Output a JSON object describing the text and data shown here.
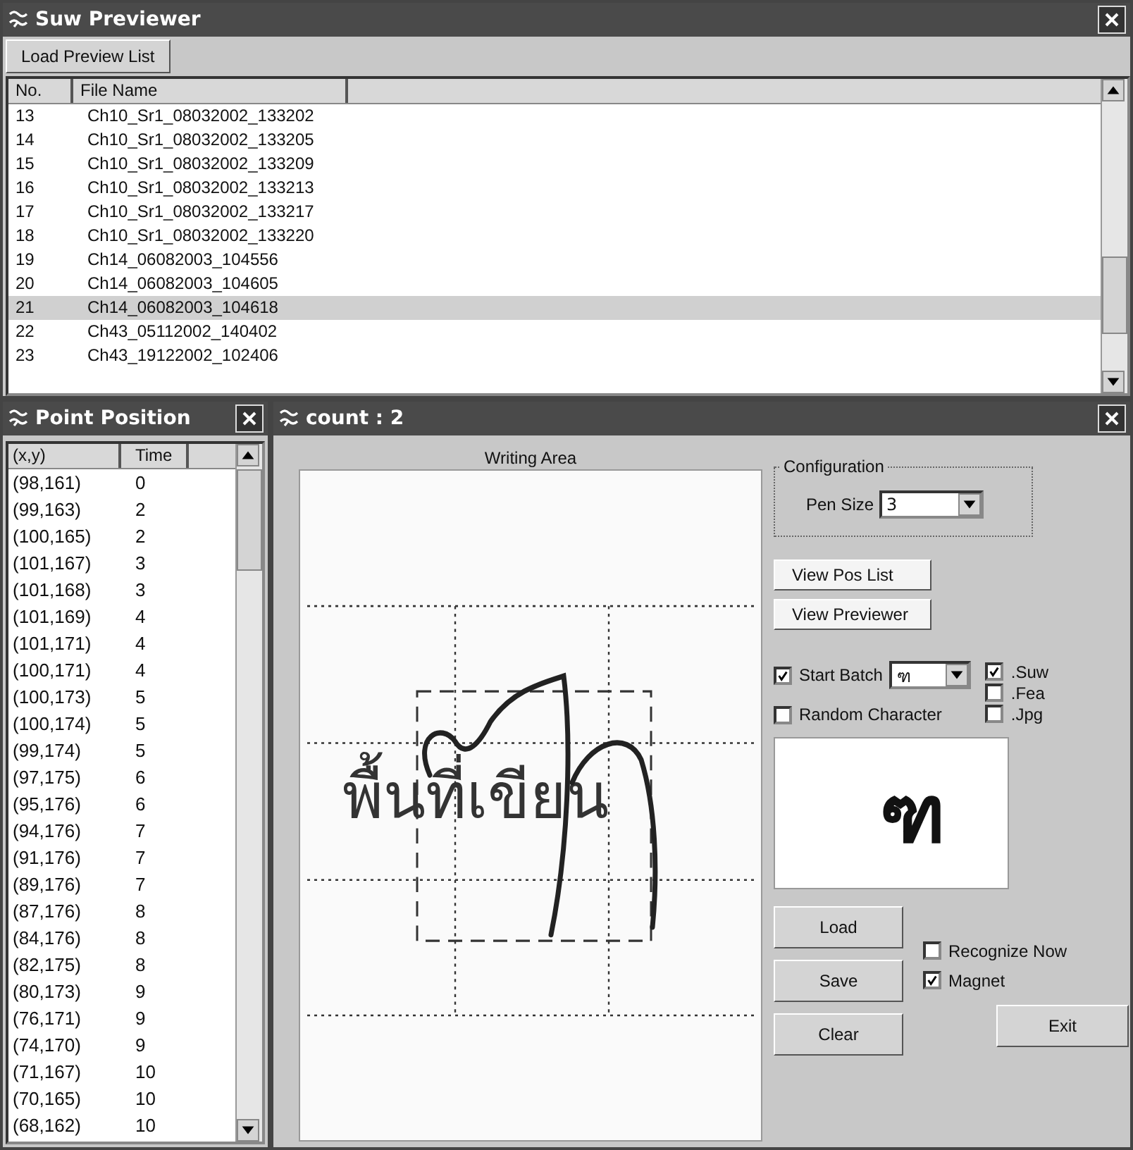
{
  "previewer": {
    "title": "Suw Previewer",
    "toolbar_button": "Load Preview List",
    "columns": [
      "No.",
      "File Name"
    ],
    "rows": [
      {
        "no": "13",
        "file": "Ch10_Sr1_08032002_133202",
        "selected": false
      },
      {
        "no": "14",
        "file": "Ch10_Sr1_08032002_133205",
        "selected": false
      },
      {
        "no": "15",
        "file": "Ch10_Sr1_08032002_133209",
        "selected": false
      },
      {
        "no": "16",
        "file": "Ch10_Sr1_08032002_133213",
        "selected": false
      },
      {
        "no": "17",
        "file": "Ch10_Sr1_08032002_133217",
        "selected": false
      },
      {
        "no": "18",
        "file": "Ch10_Sr1_08032002_133220",
        "selected": false
      },
      {
        "no": "19",
        "file": "Ch14_06082003_104556",
        "selected": false
      },
      {
        "no": "20",
        "file": "Ch14_06082003_104605",
        "selected": false
      },
      {
        "no": "21",
        "file": "Ch14_06082003_104618",
        "selected": true
      },
      {
        "no": "22",
        "file": "Ch43_05112002_140402",
        "selected": false
      },
      {
        "no": "23",
        "file": "Ch43_19122002_102406",
        "selected": false
      }
    ]
  },
  "point_position": {
    "title": "Point Position",
    "columns": [
      "(x,y)",
      "Time"
    ],
    "rows": [
      {
        "xy": "(98,161)",
        "time": "0"
      },
      {
        "xy": "(99,163)",
        "time": "2"
      },
      {
        "xy": "(100,165)",
        "time": "2"
      },
      {
        "xy": "(101,167)",
        "time": "3"
      },
      {
        "xy": "(101,168)",
        "time": "3"
      },
      {
        "xy": "(101,169)",
        "time": "4"
      },
      {
        "xy": "(101,171)",
        "time": "4"
      },
      {
        "xy": "(100,171)",
        "time": "4"
      },
      {
        "xy": "(100,173)",
        "time": "5"
      },
      {
        "xy": "(100,174)",
        "time": "5"
      },
      {
        "xy": "(99,174)",
        "time": "5"
      },
      {
        "xy": "(97,175)",
        "time": "6"
      },
      {
        "xy": "(95,176)",
        "time": "6"
      },
      {
        "xy": "(94,176)",
        "time": "7"
      },
      {
        "xy": "(91,176)",
        "time": "7"
      },
      {
        "xy": "(89,176)",
        "time": "7"
      },
      {
        "xy": "(87,176)",
        "time": "8"
      },
      {
        "xy": "(84,176)",
        "time": "8"
      },
      {
        "xy": "(82,175)",
        "time": "8"
      },
      {
        "xy": "(80,173)",
        "time": "9"
      },
      {
        "xy": "(76,171)",
        "time": "9"
      },
      {
        "xy": "(74,170)",
        "time": "9"
      },
      {
        "xy": "(71,167)",
        "time": "10"
      },
      {
        "xy": "(70,165)",
        "time": "10"
      },
      {
        "xy": "(68,162)",
        "time": "10"
      }
    ]
  },
  "editor": {
    "title": "count : 2",
    "writing_area": {
      "label": "Writing Area",
      "guide_text": "พื้นที่เขียน"
    },
    "configuration": {
      "label": "Configuration",
      "pen_size_label": "Pen Size",
      "pen_size": "3"
    },
    "view_buttons": [
      "View Pos List",
      "View Previewer"
    ],
    "start_batch": {
      "label": "Start Batch",
      "checked": true,
      "value": "ฑ"
    },
    "random_character": {
      "label": "Random Character",
      "checked": false
    },
    "formats": [
      {
        "label": ".Suw",
        "checked": true
      },
      {
        "label": ".Fea",
        "checked": false
      },
      {
        "label": ".Jpg",
        "checked": false
      }
    ],
    "preview_character": "ฑ",
    "action_buttons": [
      "Load",
      "Save",
      "Clear"
    ],
    "options": [
      {
        "label": "Recognize Now",
        "checked": false
      },
      {
        "label": "Magnet",
        "checked": true
      }
    ],
    "exit_button": "Exit"
  }
}
